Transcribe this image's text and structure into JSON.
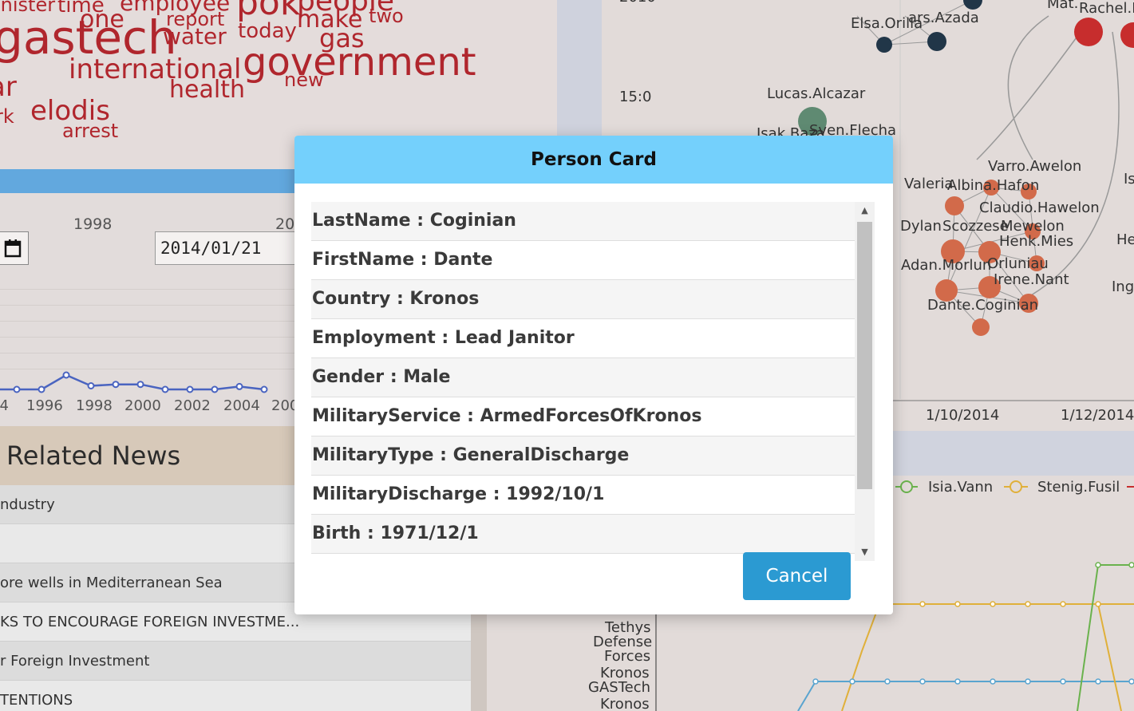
{
  "wordcloud": {
    "words": [
      {
        "text": "inister",
        "color": "#b0262d"
      },
      {
        "text": "time",
        "color": "#b0262d"
      },
      {
        "text": "employee",
        "color": "#b0262d"
      },
      {
        "text": "pok",
        "color": "#b0262d"
      },
      {
        "text": "people",
        "color": "#b0262d"
      },
      {
        "text": "one",
        "color": "#b0262d"
      },
      {
        "text": "report",
        "color": "#b0262d"
      },
      {
        "text": "make",
        "color": "#b0262d"
      },
      {
        "text": "two",
        "color": "#b0262d"
      },
      {
        "text": "gastech",
        "color": "#b0262d"
      },
      {
        "text": "water",
        "color": "#b0262d"
      },
      {
        "text": "today",
        "color": "#b0262d"
      },
      {
        "text": "gas",
        "color": "#b0262d"
      },
      {
        "text": "international",
        "color": "#b0262d"
      },
      {
        "text": "government",
        "color": "#b0262d"
      },
      {
        "text": "ar",
        "color": "#b0262d"
      },
      {
        "text": "new",
        "color": "#b0262d"
      },
      {
        "text": "health",
        "color": "#b0262d"
      },
      {
        "text": "rk",
        "color": "#b0262d"
      },
      {
        "text": "elodis",
        "color": "#b0262d"
      },
      {
        "text": "arrest",
        "color": "#b0262d"
      }
    ]
  },
  "timeline": {
    "top_ticks": [
      "1998",
      "20"
    ],
    "date_value": "2014/01/21",
    "calendar_icon": "calendar-icon",
    "x_labels": [
      "94",
      "1996",
      "1998",
      "2000",
      "2002",
      "2004",
      "200"
    ],
    "series_color": "#4a64c0",
    "points": [
      0.0,
      0.0,
      0.0,
      1.0,
      0.25,
      0.35,
      0.35,
      0.0,
      0.0,
      0.0,
      0.2,
      0.0
    ]
  },
  "news": {
    "title": "Related News",
    "items": [
      "ndustry",
      "",
      "ore wells in Mediterranean Sea",
      "KS TO ENCOURAGE FOREIGN INVESTME...",
      "r Foreign Investment",
      "TENTIONS"
    ]
  },
  "network": {
    "y_labels": [
      "15:0"
    ],
    "x_labels": [
      "1/10/2014",
      "1/12/2014"
    ],
    "top_partial_label": "2010",
    "labels": [
      "Elsa.Orilla",
      "ars.Azada",
      "Mat.",
      "Rachel.P",
      "Lucas.Alcazar",
      "Isak.Baza",
      "Sven.Flecha",
      "Varro.Awelon",
      "Valeria",
      "Albina.Hafon",
      "Is",
      "Claudio.Hawelon",
      "Dylan",
      "Scozzese",
      "Mewelon",
      "He",
      "Henk.Mies",
      "Adan.Morlun",
      "Orluniau",
      "Irene.Nant",
      "Ing",
      "Dante.Coginian"
    ],
    "node_colors": {
      "orange": "#d26a4a",
      "navy": "#213648",
      "red": "#c72d2d",
      "green": "#5f8a72"
    }
  },
  "line_chart": {
    "legend": [
      {
        "name": "Isia.Vann",
        "color": "#6ab24d"
      },
      {
        "name": "Stenig.Fusil",
        "color": "#e0b03a"
      }
    ],
    "y_categories": [
      "Tethys",
      "Defense",
      "Forces",
      "Kronos",
      "GASTech",
      "Kronos"
    ],
    "series_colors": [
      "#6ab24d",
      "#e0b03a",
      "#5aa4cf"
    ]
  },
  "modal": {
    "title": "Person Card",
    "rows": [
      "LastName : Coginian",
      "FirstName : Dante",
      "Country : Kronos",
      "Employment : Lead Janitor",
      "Gender : Male",
      "MilitaryService : ArmedForcesOfKronos",
      "MilitaryType : GeneralDischarge",
      "MilitaryDischarge : 1992/10/1",
      "Birth : 1971/12/1"
    ],
    "cancel_label": "Cancel",
    "scroll_up_icon": "▲",
    "scroll_down_icon": "▼",
    "scroll_position": 0.0
  }
}
